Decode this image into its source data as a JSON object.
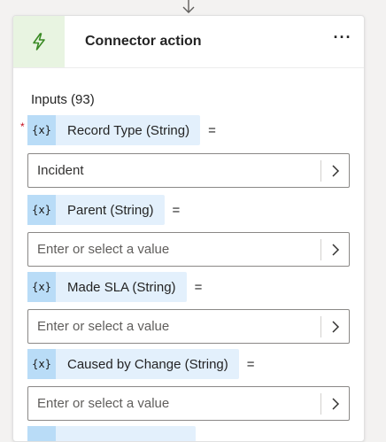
{
  "card": {
    "title": "Connector action",
    "more_label": "···",
    "accent_color": "#e8f4e1",
    "icon": "lightning-bolt-icon"
  },
  "inputs": {
    "label": "Inputs (93)",
    "params": [
      {
        "label": "Record Type (String)",
        "required": true,
        "var_icon": "{x}",
        "equals": "=",
        "value": "Incident",
        "placeholder": ""
      },
      {
        "label": "Parent (String)",
        "required": false,
        "var_icon": "{x}",
        "equals": "=",
        "value": "",
        "placeholder": "Enter or select a value"
      },
      {
        "label": "Made SLA (String)",
        "required": false,
        "var_icon": "{x}",
        "equals": "=",
        "value": "",
        "placeholder": "Enter or select a value"
      },
      {
        "label": "Caused by Change (String)",
        "required": false,
        "var_icon": "{x}",
        "equals": "=",
        "value": "",
        "placeholder": "Enter or select a value"
      }
    ]
  },
  "required_marker": "*"
}
